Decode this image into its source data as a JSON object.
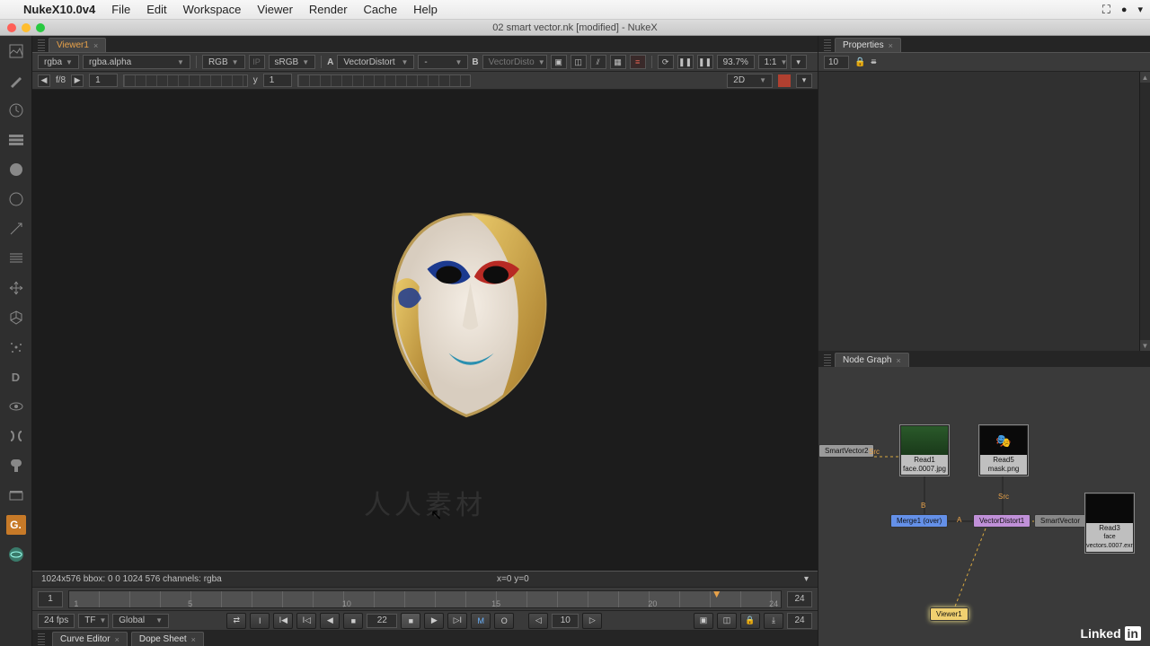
{
  "menubar": {
    "app": "NukeX10.0v4",
    "items": [
      "File",
      "Edit",
      "Workspace",
      "Viewer",
      "Render",
      "Cache",
      "Help"
    ]
  },
  "window_title": "02 smart vector.nk [modified] - NukeX",
  "viewer_tab": "Viewer1",
  "properties_tab": "Properties",
  "nodegraph_tab": "Node Graph",
  "curve_tab": "Curve Editor",
  "dope_tab": "Dope Sheet",
  "viewer_toolbar": {
    "channels": "rgba",
    "layer": "rgba.alpha",
    "display": "RGB",
    "ip": "IP",
    "colorspace": "sRGB",
    "a_label": "A",
    "a_node": "VectorDistort",
    "a_dash": "-",
    "b_label": "B",
    "b_node": "VectorDisto",
    "pct": "93.7%",
    "ratio": "1:1"
  },
  "toolbar2": {
    "f8": "f/8",
    "one": "1",
    "y": "y",
    "yval": "1",
    "mode2d": "2D"
  },
  "status": {
    "info": "1024x576  bbox: 0 0 1024 576 channels: rgba",
    "xy": "x=0 y=0"
  },
  "timeline": {
    "start": "1",
    "end": "24",
    "ticks": [
      "1",
      "5",
      "10",
      "15",
      "20",
      "24"
    ],
    "marker_frame": 22
  },
  "playbar": {
    "fps": "24 fps",
    "tf": "TF",
    "global": "Global",
    "frame": "22",
    "j": "M",
    "o": "O",
    "skip": "10",
    "end": "24"
  },
  "properties": {
    "count": "10"
  },
  "nodes": {
    "smartvector2": "SmartVector2",
    "src1": "Src",
    "read1": "Read1",
    "read1_file": "face.0007.jpg",
    "read5": "Read5",
    "read5_file": "mask.png",
    "b": "B",
    "merge1": "Merge1 (over)",
    "a": "A",
    "vectordistort1": "VectorDistort1",
    "smartvector": "SmartVector",
    "src2": "Src",
    "read3": "Read3",
    "read3_file": "face vectors.0007.exr",
    "viewer1": "Viewer1"
  },
  "watermark": "人人素材",
  "linkedin": "Linked"
}
